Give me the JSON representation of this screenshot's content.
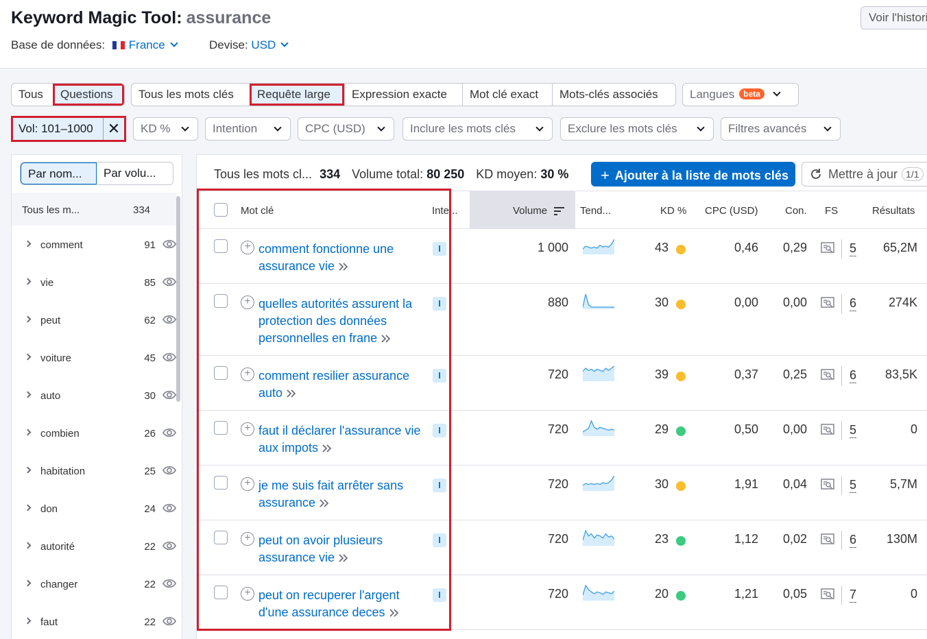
{
  "header": {
    "tool_name": "Keyword Magic Tool:",
    "query": "assurance",
    "history_button": "Voir l'historique",
    "database_label": "Base de données:",
    "database_value": "France",
    "currency_label": "Devise:",
    "currency_value": "USD"
  },
  "match_tabs": {
    "group1": [
      "Tous",
      "Questions"
    ],
    "group2": [
      "Tous les mots clés",
      "Requête large",
      "Expression exacte",
      "Mot clé exact",
      "Mots-clés associés"
    ],
    "langues": "Langues",
    "beta": "beta"
  },
  "filters": {
    "volume_chip": "Vol: 101–1000",
    "remove": "✕",
    "dropdowns": [
      "KD %",
      "Intention",
      "CPC (USD)",
      "Inclure les mots clés",
      "Exclure les mots clés",
      "Filtres avancés"
    ]
  },
  "groups_panel": {
    "sort_by_name": "Par nom...",
    "sort_by_volume": "Par volu...",
    "all_label": "Tous les m...",
    "all_count": "334",
    "items": [
      {
        "word": "comment",
        "count": "91"
      },
      {
        "word": "vie",
        "count": "85"
      },
      {
        "word": "peut",
        "count": "62"
      },
      {
        "word": "voiture",
        "count": "45"
      },
      {
        "word": "auto",
        "count": "30"
      },
      {
        "word": "combien",
        "count": "26"
      },
      {
        "word": "habitation",
        "count": "25"
      },
      {
        "word": "don",
        "count": "24"
      },
      {
        "word": "autorité",
        "count": "22"
      },
      {
        "word": "changer",
        "count": "22"
      },
      {
        "word": "faut",
        "count": "22"
      }
    ]
  },
  "summary": {
    "all_keywords_label": "Tous les mots cl...",
    "all_keywords_count": "334",
    "total_volume_label": "Volume total:",
    "total_volume": "80 250",
    "avg_kd_label": "KD moyen:",
    "avg_kd": "30 %",
    "add_button": "Ajouter à la liste de mots clés",
    "refresh_button": "Mettre à jour",
    "page": "1/1"
  },
  "table": {
    "headers": {
      "keyword": "Mot clé",
      "intent": "Inte...",
      "volume": "Volume",
      "trend": "Tend...",
      "kd": "KD %",
      "cpc": "CPC (USD)",
      "com": "Con.",
      "fs": "FS",
      "results": "Résultats"
    },
    "rows": [
      {
        "keyword": "comment fonctionne une assurance vie",
        "intent": "I",
        "volume": "1 000",
        "kd": "43",
        "kd_color": "#f9bd2d",
        "cpc": "0,46",
        "com": "0,29",
        "fs": "5",
        "results": "65,2M",
        "trend": [
          4,
          7,
          6,
          5,
          6,
          5,
          8,
          6,
          7,
          6,
          9,
          14
        ]
      },
      {
        "keyword": "quelles autorités assurent la protection des données personnelles en frane",
        "intent": "I",
        "volume": "880",
        "kd": "30",
        "kd_color": "#f9bd2d",
        "cpc": "0,00",
        "com": "0,00",
        "fs": "6",
        "results": "274K",
        "trend": [
          1,
          18,
          4,
          1,
          1,
          1,
          1,
          1,
          1,
          1,
          1,
          1
        ]
      },
      {
        "keyword": "comment resilier assurance auto",
        "intent": "I",
        "volume": "720",
        "kd": "39",
        "kd_color": "#f9bd2d",
        "cpc": "0,37",
        "com": "0,25",
        "fs": "6",
        "results": "83,5K",
        "trend": [
          8,
          11,
          9,
          10,
          8,
          10,
          9,
          8,
          11,
          9,
          11,
          13
        ]
      },
      {
        "keyword": "faut il déclarer l'assurance vie aux impots",
        "intent": "I",
        "volume": "720",
        "kd": "29",
        "kd_color": "#3ccb7f",
        "cpc": "0,50",
        "com": "0,00",
        "fs": "5",
        "results": "0",
        "trend": [
          3,
          5,
          7,
          15,
          8,
          6,
          8,
          7,
          6,
          5,
          6,
          5
        ]
      },
      {
        "keyword": "je me suis fait arrêter sans assurance",
        "intent": "I",
        "volume": "720",
        "kd": "30",
        "kd_color": "#f9bd2d",
        "cpc": "1,91",
        "com": "0,04",
        "fs": "5",
        "results": "5,7M",
        "trend": [
          5,
          7,
          6,
          7,
          6,
          7,
          6,
          8,
          7,
          8,
          11,
          16
        ]
      },
      {
        "keyword": "peut on avoir plusieurs assurance vie",
        "intent": "I",
        "volume": "720",
        "kd": "23",
        "kd_color": "#3ccb7f",
        "cpc": "1,12",
        "com": "0,02",
        "fs": "6",
        "results": "130M",
        "trend": [
          4,
          13,
          8,
          10,
          6,
          9,
          8,
          6,
          10,
          7,
          8,
          5
        ]
      },
      {
        "keyword": "peut on recuperer l'argent d'une assurance deces",
        "intent": "I",
        "volume": "720",
        "kd": "20",
        "kd_color": "#3ccb7f",
        "cpc": "1,21",
        "com": "0,05",
        "fs": "7",
        "results": "0",
        "trend": [
          5,
          17,
          12,
          9,
          7,
          9,
          8,
          6,
          9,
          8,
          7,
          10
        ]
      }
    ]
  }
}
